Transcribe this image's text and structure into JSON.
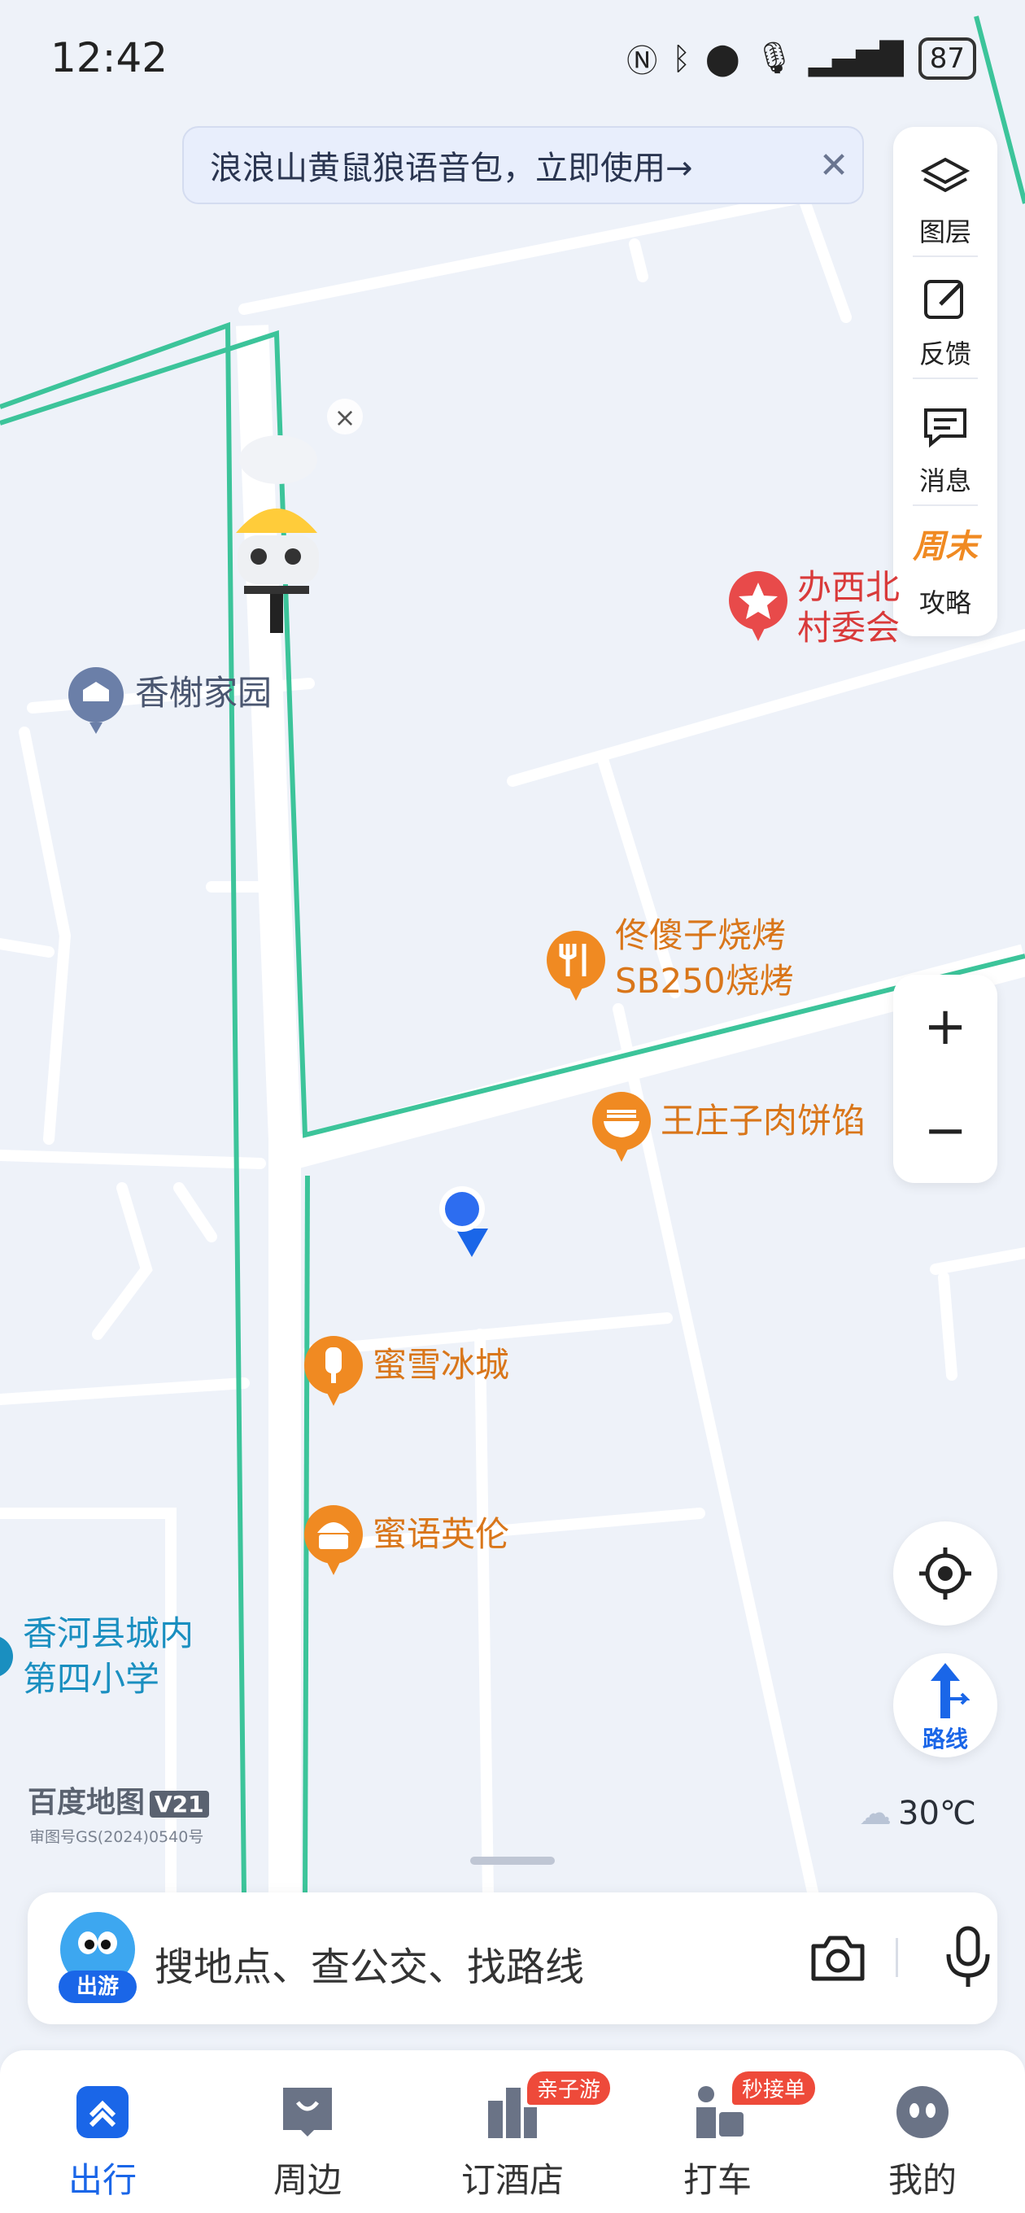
{
  "status_bar": {
    "time": "12:42",
    "battery": "87"
  },
  "banner": {
    "text": "浪浪山黄鼠狼语音包，立即使用→",
    "close": "✕"
  },
  "map_tools": [
    {
      "label": "图层",
      "icon": "layers-icon"
    },
    {
      "label": "反馈",
      "icon": "feedback-icon"
    },
    {
      "label": "消息",
      "icon": "message-icon"
    },
    {
      "label": "攻略",
      "icon": "weekend-guide-icon",
      "badge": "周末"
    }
  ],
  "zoom": {
    "in": "+",
    "out": "−"
  },
  "route_button": {
    "label": "路线"
  },
  "pois": {
    "xiangshu": "香榭家园",
    "banxi_1": "办西北",
    "banxi_2": "村委会",
    "bbq_1": "佟傻子烧烤",
    "bbq_2": "SB250烧烤",
    "wangzhuang": "王庄子肉饼馅",
    "mixue": "蜜雪冰城",
    "miyu": "蜜语英伦",
    "school_1": "香河县城内",
    "school_2": "第四小学"
  },
  "colors": {
    "accent": "#1a66e8",
    "restaurant": "#f08a22",
    "landmark": "#e84a4a",
    "residential": "#6b7fa8",
    "school": "#1a8fc0",
    "boundary": "#3cc49a"
  },
  "logo": {
    "name": "百度地图",
    "version": "V21",
    "approval": "审图号GS(2024)0540号"
  },
  "weather": {
    "temp": "30℃"
  },
  "search": {
    "placeholder": "搜地点、查公交、找路线",
    "avatar_tag": "出游"
  },
  "tabs": [
    {
      "label": "出行",
      "active": true,
      "icon": "travel-icon"
    },
    {
      "label": "周边",
      "icon": "nearby-icon"
    },
    {
      "label": "订酒店",
      "badge": "亲子游",
      "icon": "hotel-icon"
    },
    {
      "label": "打车",
      "badge": "秒接单",
      "icon": "taxi-icon"
    },
    {
      "label": "我的",
      "icon": "profile-icon"
    }
  ]
}
